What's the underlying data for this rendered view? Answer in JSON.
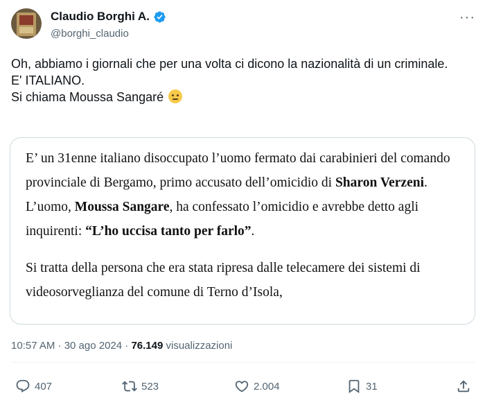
{
  "author": {
    "display_name": "Claudio Borghi A.",
    "handle": "@borghi_claudio",
    "verified_color": "#1d9bf0"
  },
  "tweet": {
    "text": "Oh, abbiamo i giornali che per una volta ci dicono la nazionalità di un criminale.\nE' ITALIANO.\nSi chiama Moussa Sangaré",
    "emoji": "face-with-rolling-eyes"
  },
  "quote": {
    "p1": {
      "t1": "E’ un 31enne italiano disoccupato l’uomo fermato dai carabinieri del comando provinciale di Bergamo, primo accusato dell’omicidio di ",
      "b1": "Sharon Verzeni",
      "t2": ". L’uomo, ",
      "b2": "Moussa Sangare",
      "t3": ", ha confessato l’omicidio e avrebbe detto agli inquirenti: ",
      "b3": "“L’ho uccisa tanto per farlo”",
      "t4": "."
    },
    "p2": "Si tratta della persona che era stata ripresa dalle telecamere dei sistemi di videosorveglianza del comune di Terno d’Isola,"
  },
  "meta": {
    "timestamp": "10:57 AM · 30 ago 2024 · ",
    "views_count": "76.149",
    "views_label": " visualizzazioni"
  },
  "actions": {
    "replies": "407",
    "reposts": "523",
    "likes": "2.004",
    "bookmarks": "31"
  }
}
